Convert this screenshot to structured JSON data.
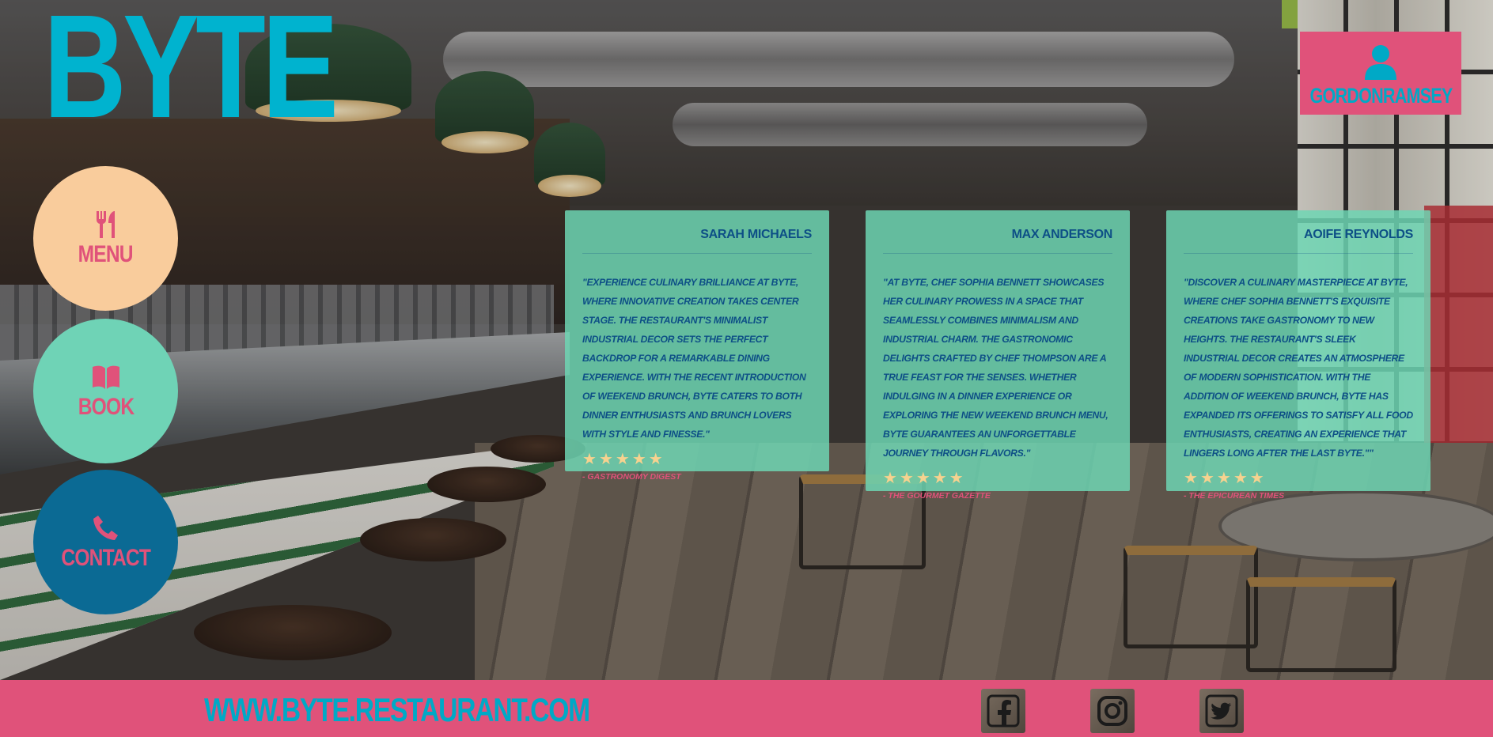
{
  "brand": {
    "logo_text": "BYTE"
  },
  "user": {
    "name": "GORDONRAMSEY",
    "icon": "user-icon"
  },
  "nav": [
    {
      "label": "MENU",
      "icon": "utensils-icon",
      "color": "#f9cc9c"
    },
    {
      "label": "BOOK",
      "icon": "book-icon",
      "color": "#6fd3b6"
    },
    {
      "label": "CONTACT",
      "icon": "phone-icon",
      "color": "#0b6a94"
    }
  ],
  "reviews": [
    {
      "reviewer": "SARAH MICHAELS",
      "quote": "\"EXPERIENCE CULINARY BRILLIANCE AT BYTE, WHERE INNOVATIVE CREATION TAKES CENTER STAGE. THE RESTAURANT'S MINIMALIST INDUSTRIAL DECOR SETS THE PERFECT BACKDROP FOR A REMARKABLE DINING EXPERIENCE. WITH THE RECENT INTRODUCTION OF WEEKEND BRUNCH, BYTE CATERS TO BOTH DINNER ENTHUSIASTS AND BRUNCH LOVERS WITH STYLE AND FINESSE.\"",
      "stars": 5,
      "source": "- GASTRONOMY DIGEST"
    },
    {
      "reviewer": "MAX ANDERSON",
      "quote": "\"AT BYTE, CHEF SOPHIA BENNETT SHOWCASES HER CULINARY PROWESS IN A SPACE THAT SEAMLESSLY COMBINES MINIMALISM AND INDUSTRIAL CHARM. THE GASTRONOMIC DELIGHTS CRAFTED BY CHEF THOMPSON ARE A TRUE FEAST FOR THE SENSES. WHETHER INDULGING IN A DINNER EXPERIENCE OR EXPLORING THE NEW WEEKEND BRUNCH MENU, BYTE GUARANTEES AN UNFORGETTABLE JOURNEY THROUGH FLAVORS.\"",
      "stars": 5,
      "source": "- THE GOURMET GAZETTE"
    },
    {
      "reviewer": "AOIFE REYNOLDS",
      "quote": "\"DISCOVER A CULINARY MASTERPIECE AT BYTE, WHERE CHEF SOPHIA BENNETT'S EXQUISITE CREATIONS TAKE GASTRONOMY TO NEW HEIGHTS. THE RESTAURANT'S SLEEK INDUSTRIAL DECOR CREATES AN ATMOSPHERE OF MODERN SOPHISTICATION. WITH THE ADDITION OF WEEKEND BRUNCH, BYTE HAS EXPANDED ITS OFFERINGS TO SATISFY ALL FOOD ENTHUSIASTS, CREATING AN EXPERIENCE THAT LINGERS LONG AFTER THE LAST BYTE.\"\"",
      "stars": 5,
      "source": "- THE EPICUREAN TIMES"
    }
  ],
  "footer": {
    "url": "WWW.BYTE.RESTAURANT.COM",
    "social": [
      {
        "icon": "facebook-icon"
      },
      {
        "icon": "instagram-icon"
      },
      {
        "icon": "twitter-icon"
      }
    ]
  },
  "colors": {
    "accent_pink": "#e0527a",
    "accent_cyan": "#00b3cf",
    "card_mint": "#6ed6b4",
    "text_navy": "#0d4f86",
    "star": "#f6d28f"
  }
}
